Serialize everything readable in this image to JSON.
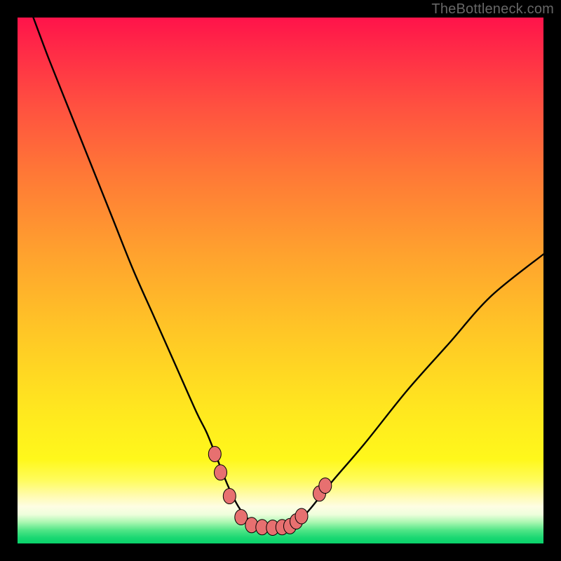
{
  "watermark": "TheBottleneck.com",
  "colors": {
    "page_bg": "#000000",
    "curve": "#000000",
    "marker_fill": "#e77070",
    "marker_stroke": "#000000",
    "gradient_top": "#ff134a",
    "gradient_bottom": "#0ad26b"
  },
  "chart_data": {
    "type": "line",
    "title": "",
    "xlabel": "",
    "ylabel": "",
    "xlim": [
      0,
      100
    ],
    "ylim": [
      0,
      100
    ],
    "note": "Values estimated from pixels. x is horizontal % across the inner plot (left→right), y is vertical % from bottom (0) to top (100). The background gradient runs top (red, high bottleneck) to bottom (green, low bottleneck). The single black curve is a V-shape with a flat minimum near y≈3 around x≈42–52; left branch starts near the top-left corner, right branch rises to roughly y≈55 at x=100.",
    "series": [
      {
        "name": "bottleneck-curve",
        "x": [
          3,
          6,
          10,
          14,
          18,
          22,
          26,
          30,
          34,
          36,
          38,
          40,
          42,
          44,
          46,
          48,
          50,
          52,
          54,
          56,
          60,
          66,
          74,
          82,
          90,
          100
        ],
        "y": [
          100,
          92,
          82,
          72,
          62,
          52,
          43,
          34,
          25,
          21,
          16,
          11,
          7,
          4.5,
          3.3,
          3,
          3,
          3.3,
          4.8,
          7,
          12,
          19,
          29,
          38,
          47,
          55
        ]
      }
    ],
    "markers": {
      "name": "highlight-dots",
      "note": "Salmon rounded markers clustered along the valley floor and one on the right ascent.",
      "points": [
        {
          "x": 37.5,
          "y": 17
        },
        {
          "x": 38.6,
          "y": 13.5
        },
        {
          "x": 40.3,
          "y": 9
        },
        {
          "x": 42.5,
          "y": 5
        },
        {
          "x": 44.5,
          "y": 3.5
        },
        {
          "x": 46.5,
          "y": 3.1
        },
        {
          "x": 48.5,
          "y": 3.0
        },
        {
          "x": 50.3,
          "y": 3.1
        },
        {
          "x": 51.8,
          "y": 3.3
        },
        {
          "x": 53.0,
          "y": 4.2
        },
        {
          "x": 54.0,
          "y": 5.2
        },
        {
          "x": 57.4,
          "y": 9.5
        },
        {
          "x": 58.5,
          "y": 11.0
        }
      ]
    }
  }
}
